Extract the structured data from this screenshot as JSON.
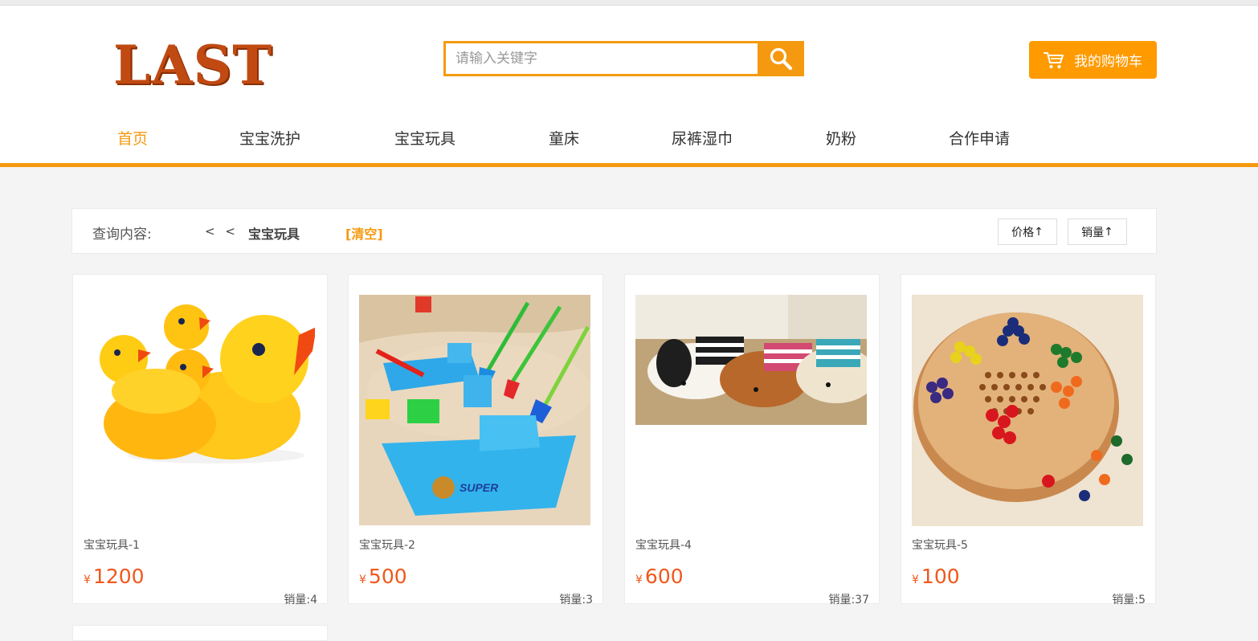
{
  "header": {
    "logo_text": "LAST",
    "search_placeholder": "请输入关键字",
    "cart_label": "我的购物车"
  },
  "nav": {
    "items": [
      "首页",
      "宝宝洗护",
      "宝宝玩具",
      "童床",
      "尿裤湿巾",
      "奶粉",
      "合作申请"
    ],
    "active": "首页"
  },
  "filter": {
    "label": "查询内容:",
    "back": "< <",
    "category": "宝宝玩具",
    "clear": "[清空]",
    "sort_price": "价格",
    "sort_sales": "销量",
    "sort_arrow": "↑"
  },
  "products": [
    {
      "name": "宝宝玩具-1",
      "currency": "¥",
      "price": "1200",
      "sales": "销量:4"
    },
    {
      "name": "宝宝玩具-2",
      "currency": "¥",
      "price": "500",
      "sales": "销量:3"
    },
    {
      "name": "宝宝玩具-4",
      "currency": "¥",
      "price": "600",
      "sales": "销量:37"
    },
    {
      "name": "宝宝玩具-5",
      "currency": "¥",
      "price": "100",
      "sales": "销量:5"
    }
  ],
  "colors": {
    "accent": "#f59a10",
    "logo": "#c04a12",
    "price": "#f0581c"
  },
  "icons": {
    "search": "search-icon",
    "cart": "cart-icon"
  }
}
